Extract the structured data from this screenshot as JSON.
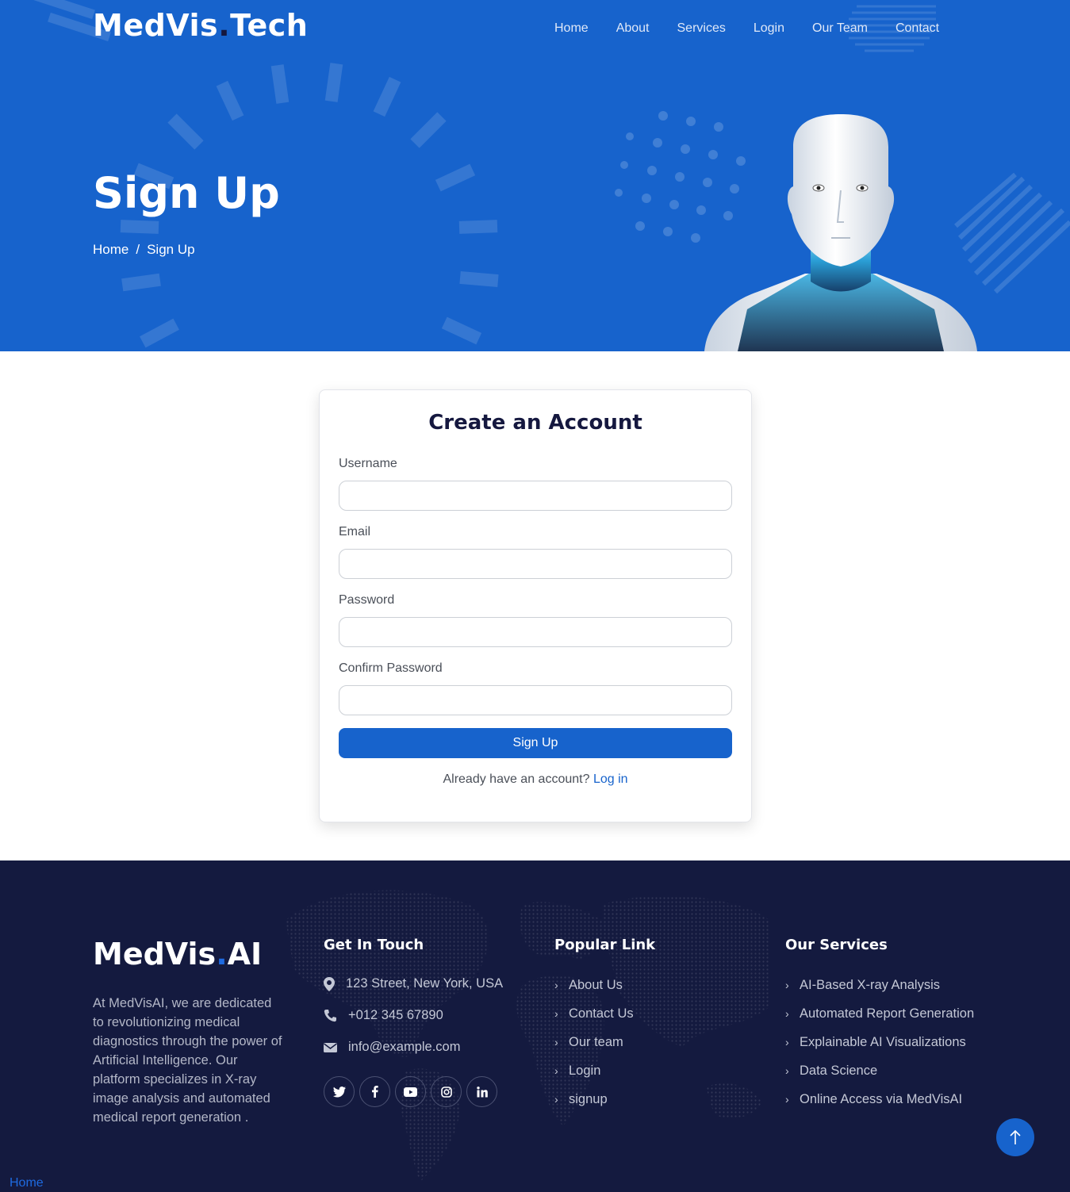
{
  "header": {
    "logo_part1": "MedVis",
    "logo_dot": ".",
    "logo_part2": "Tech",
    "nav": [
      "Home",
      "About",
      "Services",
      "Login",
      "Our Team",
      "Contact"
    ]
  },
  "hero": {
    "title": "Sign Up",
    "breadcrumb": {
      "home": "Home",
      "separator": "/",
      "current": "Sign Up"
    }
  },
  "form": {
    "title": "Create an Account",
    "fields": [
      {
        "label": "Username",
        "value": ""
      },
      {
        "label": "Email",
        "value": ""
      },
      {
        "label": "Password",
        "value": ""
      },
      {
        "label": "Confirm Password",
        "value": ""
      }
    ],
    "submit_label": "Sign Up",
    "login_prompt": "Already have an account?",
    "login_link": "Log in"
  },
  "footer": {
    "logo_part1": "MedVis",
    "logo_dot": ".",
    "logo_part2": "AI",
    "about": "At MedVisAI, we are dedicated to revolutionizing medical diagnostics through the power of Artificial Intelligence. Our platform specializes in X-ray image analysis and automated medical report generation .",
    "contact_heading": "Get In Touch",
    "address": "123 Street, New York, USA",
    "phone": "+012 345 67890",
    "email": "info@example.com",
    "socials": [
      "twitter",
      "facebook",
      "youtube",
      "instagram",
      "linkedin"
    ],
    "links_heading": "Popular Link",
    "links": [
      "About Us",
      "Contact Us",
      "Our team",
      "Login",
      "signup"
    ],
    "services_heading": "Our Services",
    "services": [
      "AI-Based X-ray Analysis",
      "Automated Report Generation",
      "Explainable AI Visualizations",
      "Data Science",
      "Online Access via MedVisAI"
    ]
  },
  "bottom_link": "Home",
  "colors": {
    "primary": "#1763cc",
    "footer_bg": "#141a3f",
    "dark_text": "#15183f"
  }
}
